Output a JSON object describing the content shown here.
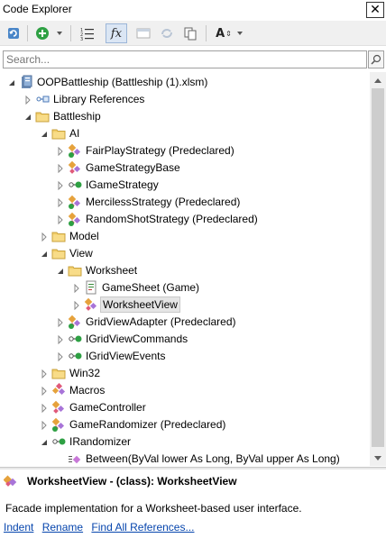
{
  "window": {
    "title": "Code Explorer",
    "close_glyph": "✕"
  },
  "toolbar": {
    "buttons": [
      {
        "name": "refresh-icon"
      },
      {
        "name": "add-icon"
      },
      {
        "name": "sort-icon"
      },
      {
        "name": "fx-icon",
        "label": "fx",
        "active": true
      },
      {
        "name": "window-icon"
      },
      {
        "name": "sync-icon"
      },
      {
        "name": "copy-icon"
      },
      {
        "name": "font-icon",
        "label": "A"
      }
    ]
  },
  "search": {
    "placeholder": "Search...",
    "value": ""
  },
  "tree": [
    {
      "level": 0,
      "expanded": true,
      "expander": "open",
      "icon": "project-icon",
      "label": "OOPBattleship (Battleship (1).xlsm)"
    },
    {
      "level": 1,
      "expanded": false,
      "expander": "closed",
      "icon": "references-icon",
      "label": "Library References"
    },
    {
      "level": 1,
      "expanded": true,
      "expander": "open",
      "icon": "folder-icon",
      "label": "Battleship"
    },
    {
      "level": 2,
      "expanded": true,
      "expander": "open",
      "icon": "folder-icon",
      "label": "AI"
    },
    {
      "level": 3,
      "expanded": false,
      "expander": "closed",
      "icon": "predeclared-class-icon",
      "label": "FairPlayStrategy (Predeclared)"
    },
    {
      "level": 3,
      "expanded": false,
      "expander": "closed",
      "icon": "class-icon",
      "label": "GameStrategyBase"
    },
    {
      "level": 3,
      "expanded": false,
      "expander": "closed",
      "icon": "interface-icon",
      "label": "IGameStrategy"
    },
    {
      "level": 3,
      "expanded": false,
      "expander": "closed",
      "icon": "predeclared-class-icon",
      "label": "MercilessStrategy (Predeclared)"
    },
    {
      "level": 3,
      "expanded": false,
      "expander": "closed",
      "icon": "predeclared-class-icon",
      "label": "RandomShotStrategy (Predeclared)"
    },
    {
      "level": 2,
      "expanded": false,
      "expander": "closed",
      "icon": "folder-icon",
      "label": "Model"
    },
    {
      "level": 2,
      "expanded": true,
      "expander": "open",
      "icon": "folder-icon",
      "label": "View"
    },
    {
      "level": 3,
      "expanded": true,
      "expander": "open",
      "icon": "folder-icon",
      "label": "Worksheet"
    },
    {
      "level": 4,
      "expanded": false,
      "expander": "closed",
      "icon": "document-icon",
      "label": "GameSheet (Game)"
    },
    {
      "level": 4,
      "expanded": false,
      "expander": "closed",
      "icon": "class-icon",
      "label": "WorksheetView",
      "selected": true
    },
    {
      "level": 3,
      "expanded": false,
      "expander": "closed",
      "icon": "predeclared-class-icon",
      "label": "GridViewAdapter (Predeclared)"
    },
    {
      "level": 3,
      "expanded": false,
      "expander": "closed",
      "icon": "interface-icon",
      "label": "IGridViewCommands"
    },
    {
      "level": 3,
      "expanded": false,
      "expander": "closed",
      "icon": "interface-icon",
      "label": "IGridViewEvents"
    },
    {
      "level": 2,
      "expanded": false,
      "expander": "closed",
      "icon": "folder-icon",
      "label": "Win32"
    },
    {
      "level": 2,
      "expanded": false,
      "expander": "closed",
      "icon": "module-icon",
      "label": "Macros"
    },
    {
      "level": 2,
      "expanded": false,
      "expander": "closed",
      "icon": "class-icon",
      "label": "GameController"
    },
    {
      "level": 2,
      "expanded": false,
      "expander": "closed",
      "icon": "predeclared-class-icon",
      "label": "GameRandomizer (Predeclared)"
    },
    {
      "level": 2,
      "expanded": true,
      "expander": "open",
      "icon": "interface-icon",
      "label": "IRandomizer"
    },
    {
      "level": 3,
      "expanded": false,
      "expander": "none",
      "icon": "method-icon",
      "label": "Between(ByVal lower As Long, ByVal upper As Long)"
    }
  ],
  "details": {
    "title": "WorksheetView - (class): WorksheetView",
    "description": "Facade implementation for a Worksheet-based user interface.",
    "links": [
      {
        "name": "indent-link",
        "label": "Indent"
      },
      {
        "name": "rename-link",
        "label": "Rename"
      },
      {
        "name": "find-all-references-link",
        "label": "Find All References..."
      }
    ]
  },
  "colors": {
    "folder": "#f3cf6b",
    "interface_green": "#2ea043",
    "link": "#0645ad",
    "selection": "#e5e5e5"
  }
}
